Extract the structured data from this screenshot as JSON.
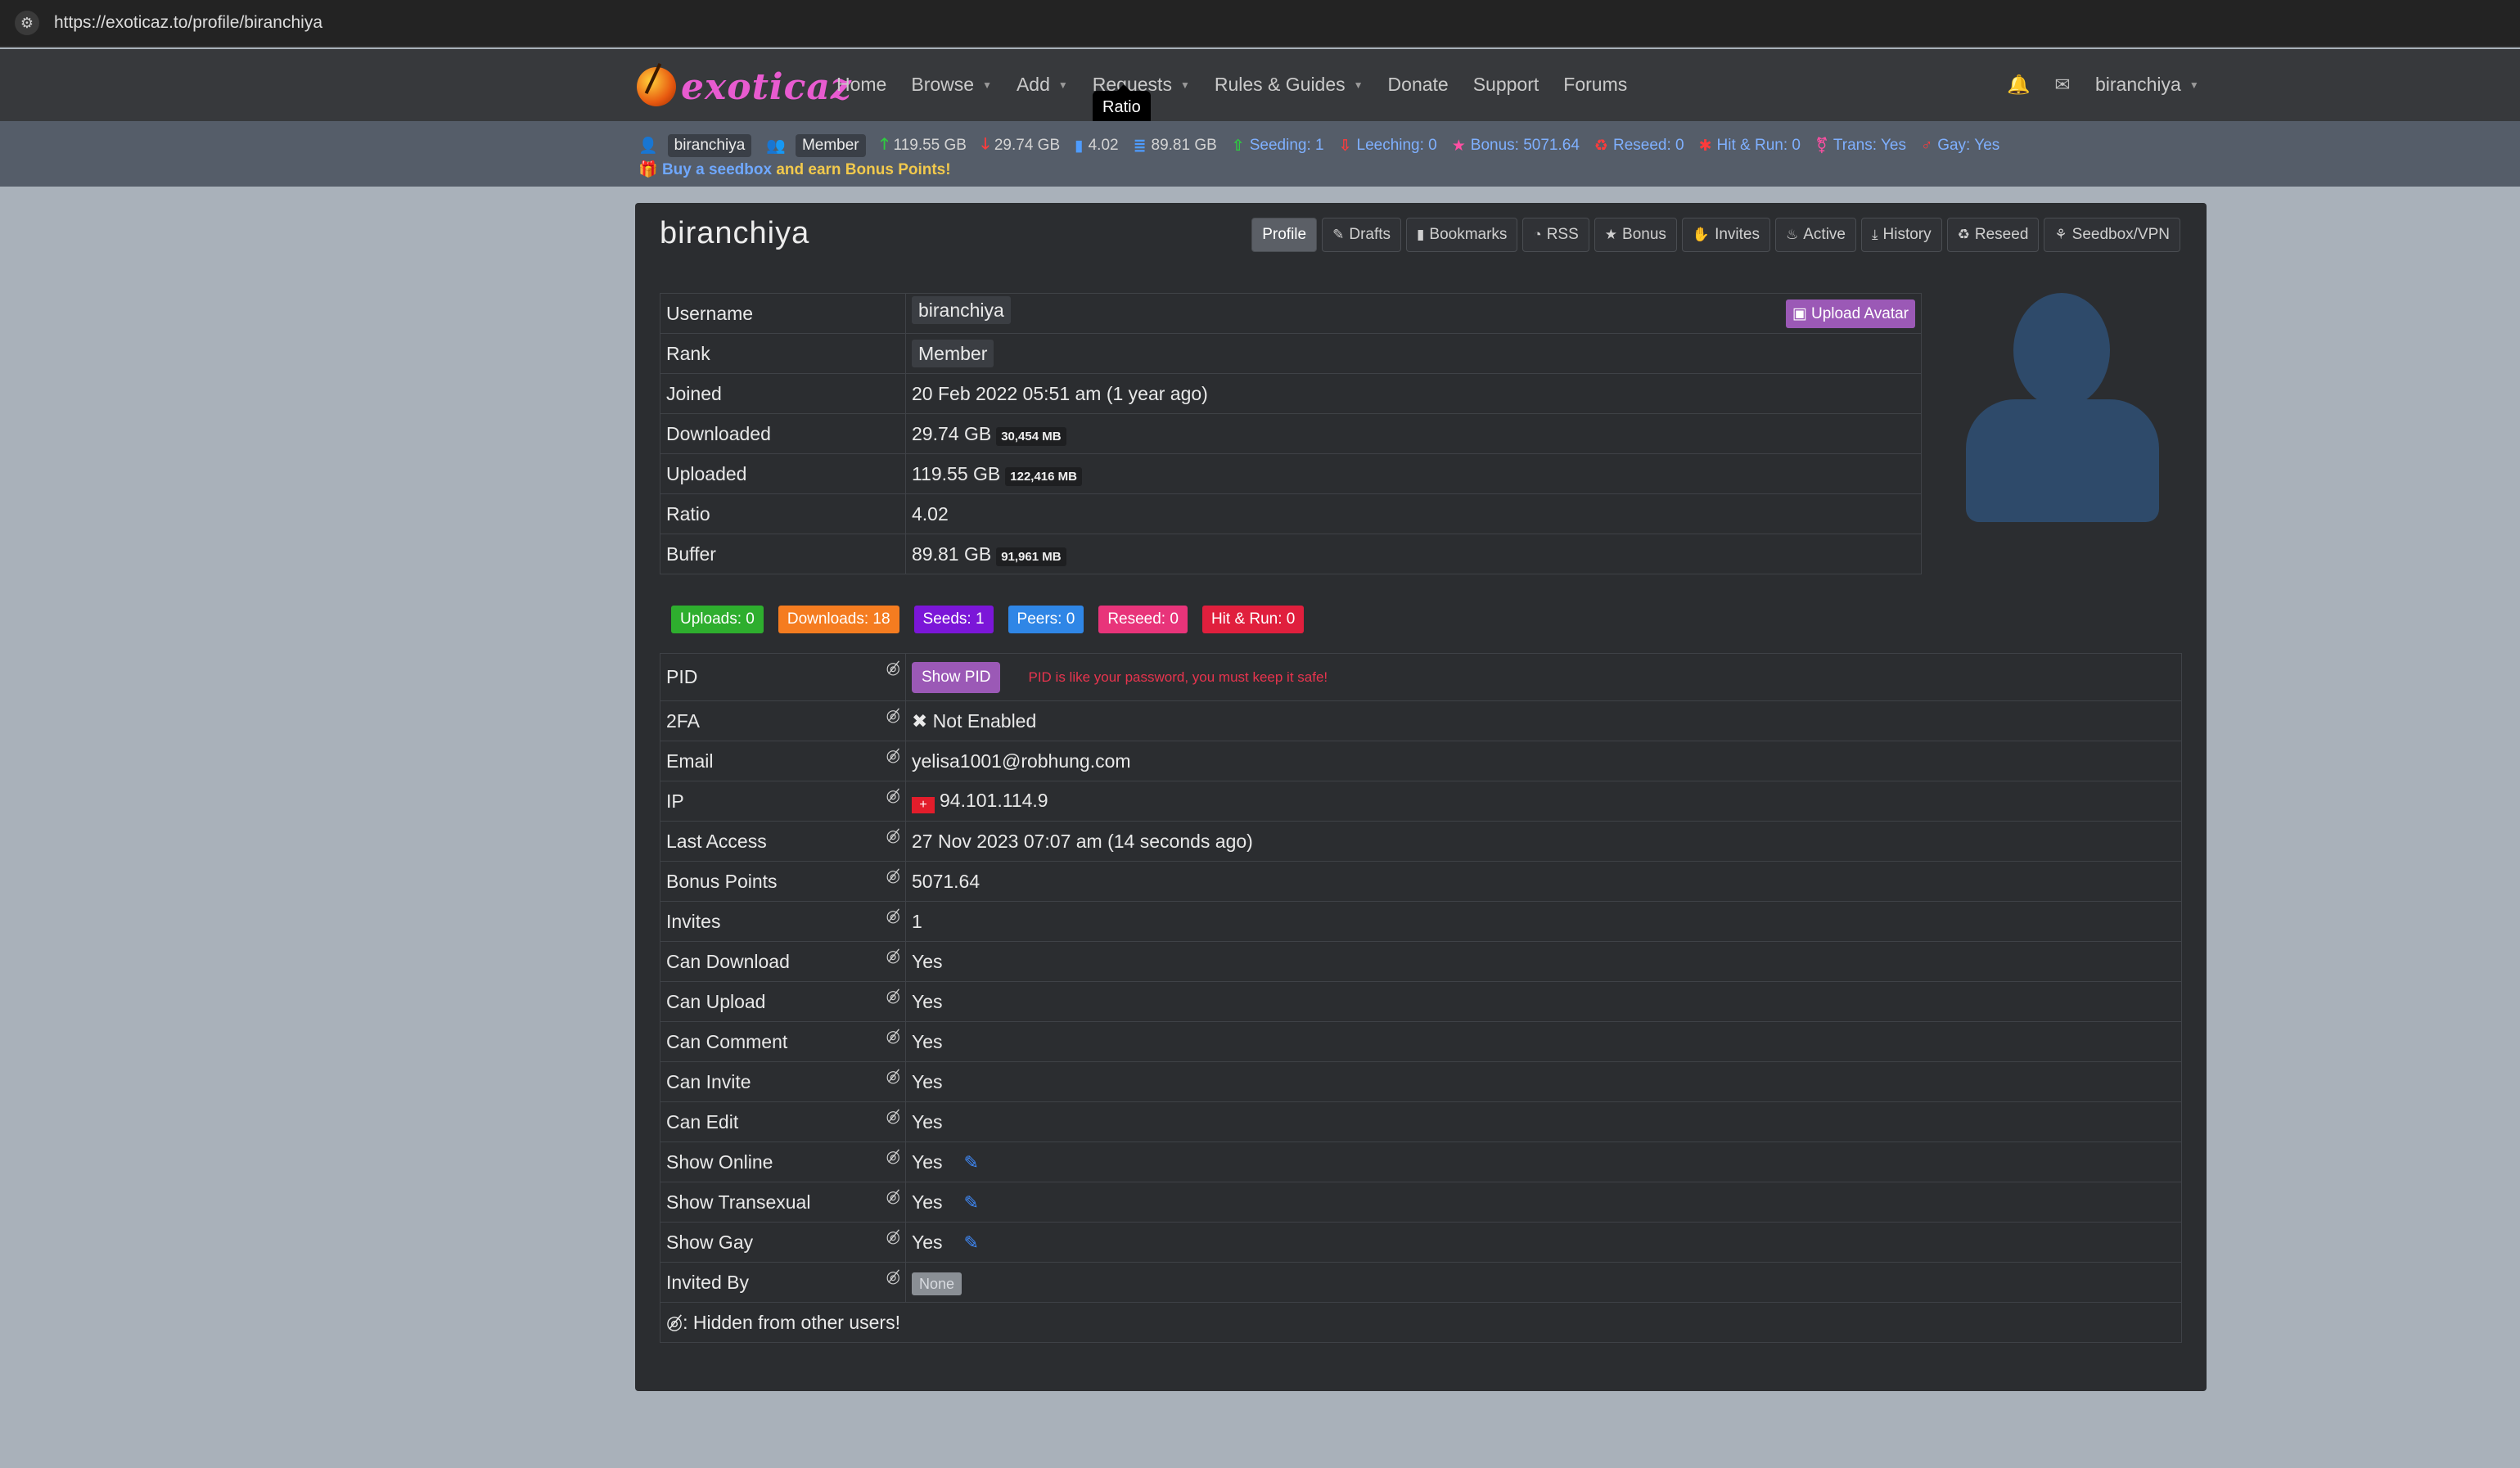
{
  "browser": {
    "url": "https://exoticaz.to/profile/biranchiya"
  },
  "nav": {
    "brand": "exoticaz",
    "links": [
      {
        "label": "Home",
        "caret": false
      },
      {
        "label": "Browse",
        "caret": true
      },
      {
        "label": "Add",
        "caret": true
      },
      {
        "label": "Requests",
        "caret": true
      },
      {
        "label": "Rules & Guides",
        "caret": true
      },
      {
        "label": "Donate",
        "caret": false
      },
      {
        "label": "Support",
        "caret": false
      },
      {
        "label": "Forums",
        "caret": false
      }
    ],
    "username": "biranchiya",
    "tooltip": "Ratio"
  },
  "stats": {
    "user": "biranchiya",
    "rank": "Member",
    "uploaded": "119.55 GB",
    "downloaded": "29.74 GB",
    "ratio": "4.02",
    "buffer": "89.81 GB",
    "seeding": "Seeding: 1",
    "leeching": "Leeching: 0",
    "bonus": "Bonus: 5071.64",
    "reseed": "Reseed: 0",
    "hitrun": "Hit & Run: 0",
    "trans": "Trans: Yes",
    "gay": "Gay: Yes",
    "promo_link": "Buy a seedbox",
    "promo_text": " and earn Bonus Points!"
  },
  "profile": {
    "title": "biranchiya",
    "tabs": [
      "Profile",
      "Drafts",
      "Bookmarks",
      "RSS",
      "Bonus",
      "Invites",
      "Active",
      "History",
      "Reseed",
      "Seedbox/VPN"
    ],
    "upload_avatar": "Upload Avatar",
    "info": [
      {
        "key": "Username",
        "value": "biranchiya"
      },
      {
        "key": "Rank",
        "value": "Member"
      },
      {
        "key": "Joined",
        "value": "20 Feb 2022 05:51 am (1 year ago)"
      },
      {
        "key": "Downloaded",
        "value": "29.74 GB",
        "mb": "30,454 MB"
      },
      {
        "key": "Uploaded",
        "value": "119.55 GB",
        "mb": "122,416 MB"
      },
      {
        "key": "Ratio",
        "value": "4.02"
      },
      {
        "key": "Buffer",
        "value": "89.81 GB",
        "mb": "91,961 MB"
      }
    ],
    "badges": [
      {
        "label": "Uploads: 0",
        "color": "#2eae2e"
      },
      {
        "label": "Downloads: 18",
        "color": "#f57c20"
      },
      {
        "label": "Seeds: 1",
        "color": "#7b16d8"
      },
      {
        "label": "Peers: 0",
        "color": "#2f86e6"
      },
      {
        "label": "Reseed: 0",
        "color": "#e8347a"
      },
      {
        "label": "Hit & Run: 0",
        "color": "#e01f3d"
      }
    ],
    "private": {
      "pid_key": "PID",
      "pid_button": "Show PID",
      "pid_warning": "PID is like your password, you must keep it safe!",
      "twofa_key": "2FA",
      "twofa_value": "Not Enabled",
      "email_key": "Email",
      "email_value": "yelisa1001@robhung.com",
      "ip_key": "IP",
      "ip_value": "94.101.114.9",
      "last_access_key": "Last Access",
      "last_access_value": "27 Nov 2023 07:07 am (14 seconds ago)",
      "bonus_key": "Bonus Points",
      "bonus_value": "5071.64",
      "invites_key": "Invites",
      "invites_value": "1",
      "can_download_key": "Can Download",
      "can_download_value": "Yes",
      "can_upload_key": "Can Upload",
      "can_upload_value": "Yes",
      "can_comment_key": "Can Comment",
      "can_comment_value": "Yes",
      "can_invite_key": "Can Invite",
      "can_invite_value": "Yes",
      "can_edit_key": "Can Edit",
      "can_edit_value": "Yes",
      "show_online_key": "Show Online",
      "show_online_value": "Yes",
      "show_trans_key": "Show Transexual",
      "show_trans_value": "Yes",
      "show_gay_key": "Show Gay",
      "show_gay_value": "Yes",
      "invited_by_key": "Invited By",
      "invited_by_value": "None",
      "legend": ": Hidden from other users!"
    }
  }
}
